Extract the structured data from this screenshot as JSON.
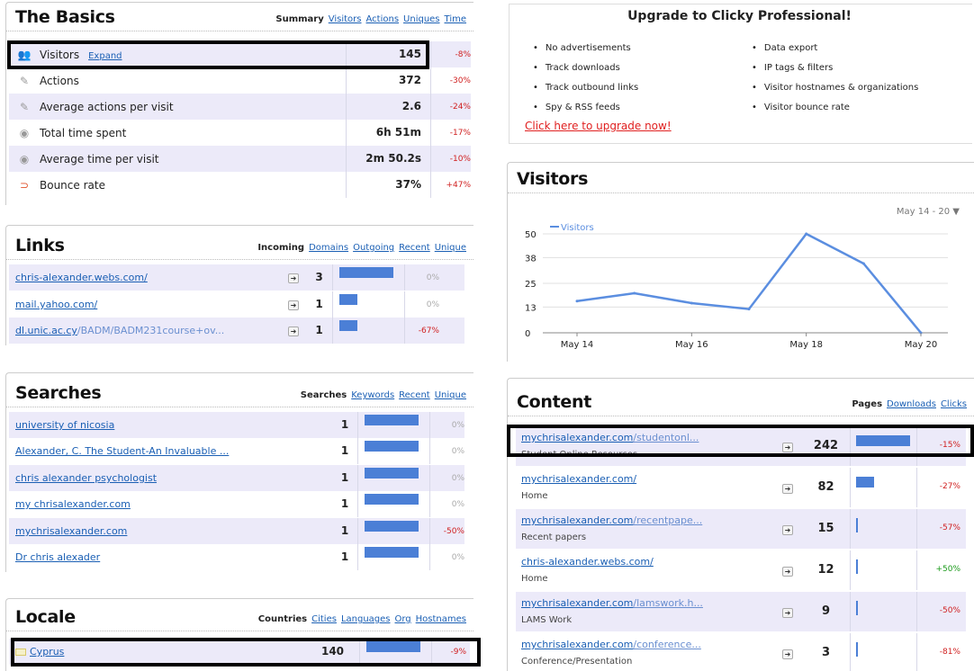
{
  "basics": {
    "title": "The Basics",
    "tabs": [
      "Summary",
      "Visitors",
      "Actions",
      "Uniques",
      "Time"
    ],
    "expand_label": "Expand",
    "rows": [
      {
        "icon": "visitors-icon",
        "glyph": "👥",
        "label": "Visitors",
        "value": "145",
        "change": "-8%"
      },
      {
        "icon": "actions-icon",
        "glyph": "✎",
        "label": "Actions",
        "value": "372",
        "change": "-30%"
      },
      {
        "icon": "actions-icon",
        "glyph": "✎",
        "label": "Average actions per visit",
        "value": "2.6",
        "change": "-24%"
      },
      {
        "icon": "clock-icon",
        "glyph": "◉",
        "label": "Total time spent",
        "value": "6h 51m",
        "change": "-17%"
      },
      {
        "icon": "clock-icon",
        "glyph": "◉",
        "label": "Average time per visit",
        "value": "2m 50.2s",
        "change": "-10%"
      },
      {
        "icon": "bounce-icon",
        "glyph": "⊃",
        "label": "Bounce rate",
        "value": "37%",
        "change": "+47%"
      }
    ]
  },
  "links": {
    "title": "Links",
    "tabs": [
      "Incoming",
      "Domains",
      "Outgoing",
      "Recent",
      "Unique"
    ],
    "rows": [
      {
        "url": "chris-alexander.webs.com/",
        "dim": "",
        "count": "3",
        "share": 1.0,
        "change": "0%"
      },
      {
        "url": "mail.yahoo.com/",
        "dim": "",
        "count": "1",
        "share": 0.33,
        "change": "0%"
      },
      {
        "url": "dl.unic.ac.cy",
        "dim": "/BADM/BADM231course+ov...",
        "count": "1",
        "share": 0.33,
        "change": "-67%"
      }
    ]
  },
  "searches": {
    "title": "Searches",
    "tabs": [
      "Searches",
      "Keywords",
      "Recent",
      "Unique"
    ],
    "rows": [
      {
        "term": "university of nicosia",
        "count": "1",
        "share": 1.0,
        "change": "0%"
      },
      {
        "term": "Alexander, C. The Student-An Invaluable ...",
        "count": "1",
        "share": 1.0,
        "change": "0%"
      },
      {
        "term": "chris alexander psychologist",
        "count": "1",
        "share": 1.0,
        "change": "0%"
      },
      {
        "term": "my chrisalexander.com",
        "count": "1",
        "share": 1.0,
        "change": "0%"
      },
      {
        "term": "mychrisalexander.com",
        "count": "1",
        "share": 1.0,
        "change": "-50%"
      },
      {
        "term": "Dr chris alexader",
        "count": "1",
        "share": 1.0,
        "change": "0%"
      }
    ]
  },
  "locale": {
    "title": "Locale",
    "tabs": [
      "Countries",
      "Cities",
      "Languages",
      "Org",
      "Hostnames"
    ],
    "rows": [
      {
        "country": "Cyprus",
        "count": "140",
        "share": 1.0,
        "change": "-9%"
      }
    ]
  },
  "upgrade": {
    "title": "Upgrade to Clicky Professional!",
    "features_left": [
      "No advertisements",
      "Track downloads",
      "Track outbound links",
      "Spy & RSS feeds"
    ],
    "features_right": [
      "Data export",
      "IP tags & filters",
      "Visitor hostnames & organizations",
      "Visitor bounce rate"
    ],
    "cta": "Click here to upgrade now!"
  },
  "visitors_chart": {
    "title": "Visitors",
    "date_range": "May 14 - 20 ▼",
    "chart_data": {
      "type": "line",
      "series": [
        {
          "name": "Visitors",
          "values": [
            16,
            20,
            15,
            12,
            50,
            35,
            0
          ]
        }
      ],
      "x": [
        "May 14",
        "May 15",
        "May 16",
        "May 17",
        "May 18",
        "May 19",
        "May 20"
      ],
      "x_tick_labels": [
        "May 14",
        "May 16",
        "May 18",
        "May 20"
      ],
      "y_ticks": [
        "0",
        "13",
        "25",
        "38",
        "50"
      ],
      "ylim": [
        0,
        50
      ],
      "color": "#5b8ee0"
    }
  },
  "content": {
    "title": "Content",
    "tabs": [
      "Pages",
      "Downloads",
      "Clicks"
    ],
    "rows": [
      {
        "domain": "mychrisalexander.com",
        "path": "/studentonl...",
        "subtitle": "Student Online Resources",
        "count": "242",
        "share": 1.0,
        "change": "-15%"
      },
      {
        "domain": "mychrisalexander.com/",
        "path": "",
        "subtitle": "Home",
        "count": "82",
        "share": 0.34,
        "change": "-27%"
      },
      {
        "domain": "mychrisalexander.com",
        "path": "/recentpape...",
        "subtitle": "Recent papers",
        "count": "15",
        "share": 0.06,
        "change": "-57%"
      },
      {
        "domain": "chris-alexander.webs.com/",
        "path": "",
        "subtitle": "Home",
        "count": "12",
        "share": 0.05,
        "change": "+50%"
      },
      {
        "domain": "mychrisalexander.com",
        "path": "/lamswork.h...",
        "subtitle": "LAMS Work",
        "count": "9",
        "share": 0.04,
        "change": "-50%"
      },
      {
        "domain": "mychrisalexander.com",
        "path": "/conference...",
        "subtitle": "Conference/Presentation",
        "count": "3",
        "share": 0.01,
        "change": "-81%"
      }
    ]
  }
}
